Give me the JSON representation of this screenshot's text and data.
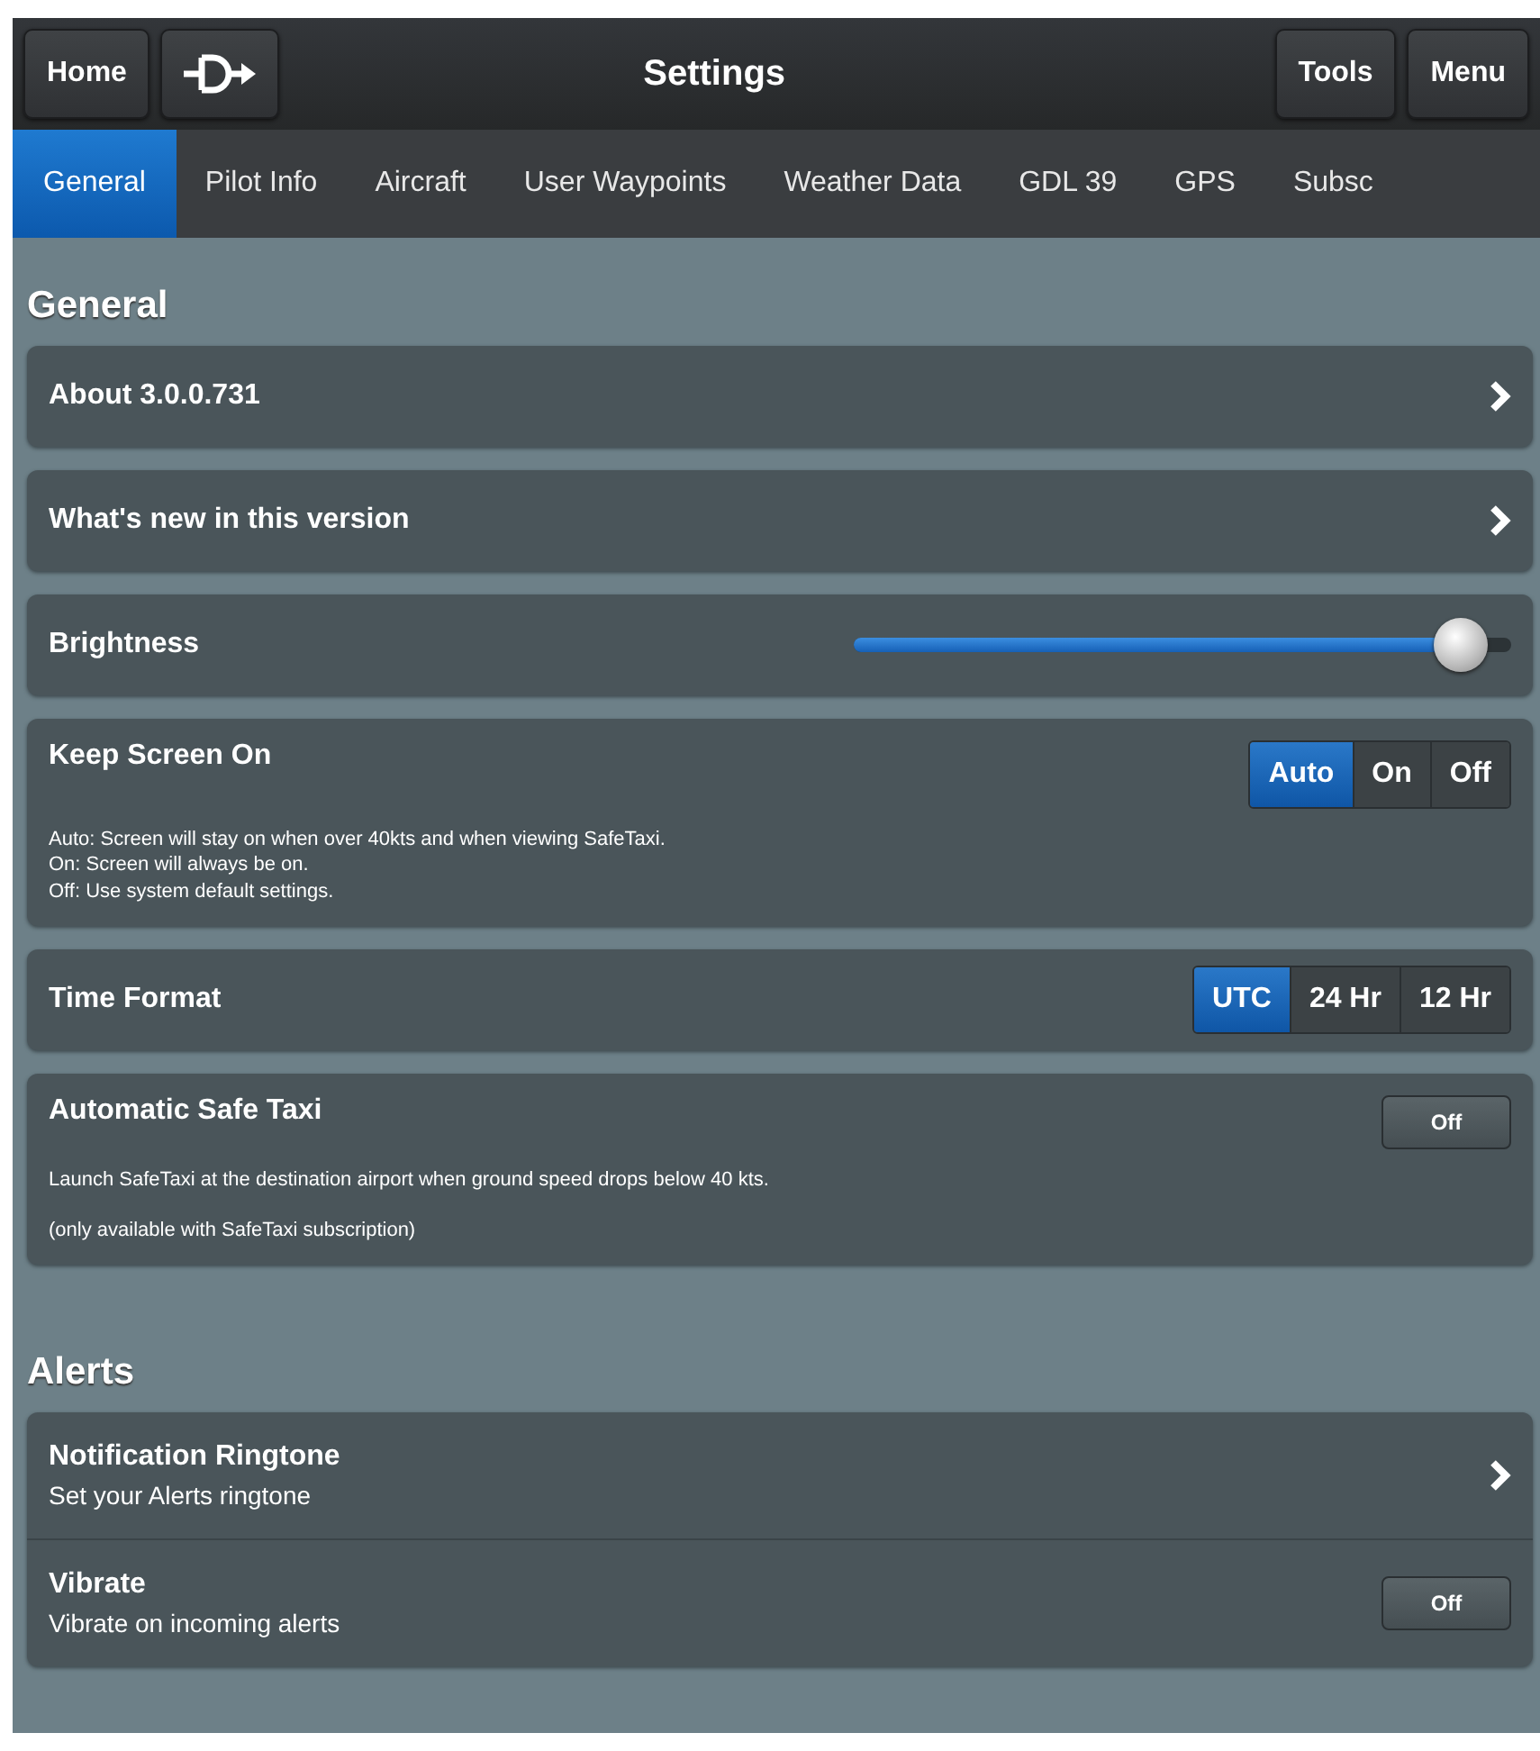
{
  "top_bar": {
    "left_buttons": [
      "Home"
    ],
    "title": "Settings",
    "right_buttons": [
      "Tools",
      "Menu"
    ]
  },
  "tabs": [
    {
      "label": "General",
      "selected": true
    },
    {
      "label": "Pilot Info",
      "selected": false
    },
    {
      "label": "Aircraft",
      "selected": false
    },
    {
      "label": "User Waypoints",
      "selected": false
    },
    {
      "label": "Weather Data",
      "selected": false
    },
    {
      "label": "GDL 39",
      "selected": false
    },
    {
      "label": "GPS",
      "selected": false
    },
    {
      "label": "Subsc",
      "selected": false
    }
  ],
  "sections": [
    {
      "title": "General",
      "grouped": false,
      "rows": [
        {
          "kind": "link",
          "label": "About 3.0.0.731"
        },
        {
          "kind": "link",
          "label": "What's new in this version"
        },
        {
          "kind": "slider",
          "label": "Brightness",
          "level": 0.96
        },
        {
          "kind": "segmented",
          "label": "Keep Screen On",
          "options": [
            {
              "label": "Auto",
              "selected": true
            },
            {
              "label": "On",
              "selected": false
            },
            {
              "label": "Off",
              "selected": false
            }
          ],
          "notes": [
            "Auto: Screen will stay on when over 40kts and when viewing SafeTaxi.",
            "On: Screen will always be on.",
            "Off: Use system default settings."
          ]
        },
        {
          "kind": "segmented",
          "label": "Time Format",
          "options": [
            {
              "label": "UTC",
              "selected": true
            },
            {
              "label": "24 Hr",
              "selected": false
            },
            {
              "label": "12 Hr",
              "selected": false
            }
          ]
        },
        {
          "kind": "toggle",
          "label": "Automatic Safe Taxi",
          "state": "Off",
          "on": false,
          "notes": [
            "Launch SafeTaxi at the destination airport when ground speed drops below 40 kts.",
            "(only available with SafeTaxi subscription)"
          ]
        }
      ]
    },
    {
      "title": "Alerts",
      "grouped": true,
      "rows": [
        {
          "kind": "link",
          "label": "Notification Ringtone",
          "subtitle": "Set your Alerts ringtone"
        },
        {
          "kind": "toggle",
          "label": "Vibrate",
          "subtitle": "Vibrate on incoming alerts",
          "state": "Off",
          "on": false
        }
      ]
    }
  ]
}
